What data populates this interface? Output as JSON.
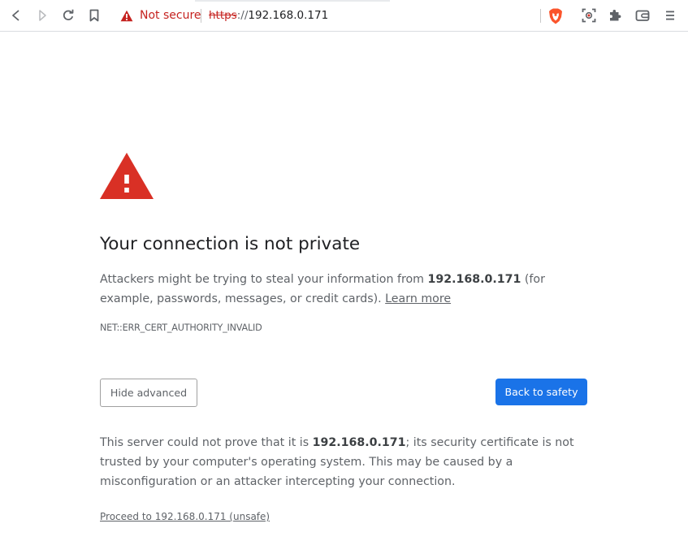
{
  "toolbar": {
    "back_icon": "back-arrow-icon",
    "forward_icon": "forward-arrow-icon",
    "reload_icon": "reload-icon",
    "bookmark_icon": "bookmark-icon",
    "security_chip": "Not secure",
    "url_scheme": "https",
    "url_separator": "://",
    "url_host": "192.168.0.171",
    "brave_icon": "brave-shields-icon",
    "extensions": [
      "screenshot-icon",
      "puzzle-extensions-icon",
      "wallet-icon",
      "menu-icon"
    ]
  },
  "interstitial": {
    "heading": "Your connection is not private",
    "explanation_prefix": "Attackers might be trying to steal your information from ",
    "explanation_host": "192.168.0.171",
    "explanation_suffix": " (for example, passwords, messages, or credit cards). ",
    "learn_more": "Learn more",
    "error_code": "NET::ERR_CERT_AUTHORITY_INVALID",
    "hide_advanced": "Hide advanced",
    "back_to_safety": "Back to safety",
    "details_prefix": "This server could not prove that it is ",
    "details_host": "192.168.0.171",
    "details_suffix": "; its security certificate is not trusted by your computer's operating system. This may be caused by a misconfiguration or an attacker intercepting your connection.",
    "proceed_link": "Proceed to 192.168.0.171 (unsafe)"
  },
  "colors": {
    "warning_red": "#d93025",
    "primary_button": "#1a73e8",
    "text": "#5f6368",
    "heading": "#202124"
  }
}
